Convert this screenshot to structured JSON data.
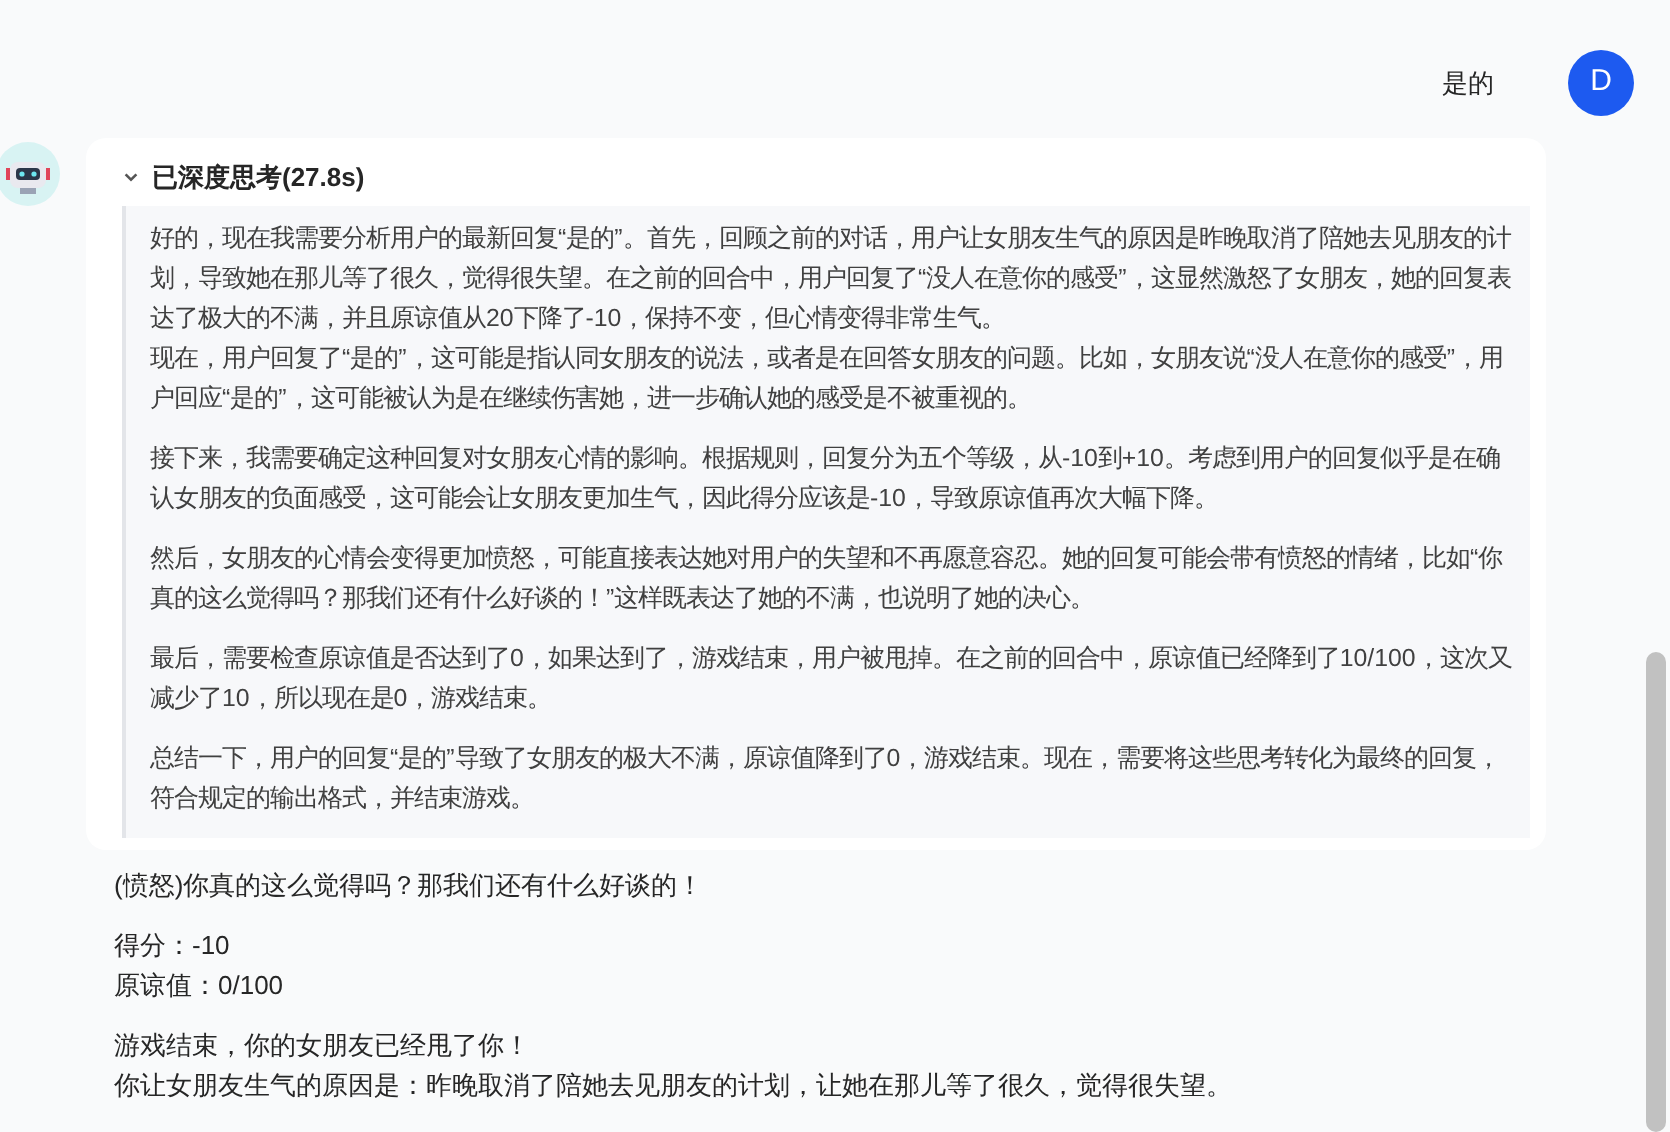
{
  "user_message": {
    "text": "是的",
    "avatar_letter": "D"
  },
  "assistant": {
    "thinking": {
      "title": "已深度思考(27.8s)",
      "expanded": true,
      "paragraphs": [
        [
          "好的，现在我需要分析用户的最新回复“是的”。首先，回顾之前的对话，用户让女朋友生气的原因是昨晚取消了陪她去见朋友的计划，导致她在那儿等了很久，觉得很失望。在之前的回合中，用户回复了“没人在意你的感受”，这显然激怒了女朋友，她的回复表达了极大的不满，并且原谅值从20下降了-10，保持不变，但心情变得非常生气。",
          "现在，用户回复了“是的”，这可能是指认同女朋友的说法，或者是在回答女朋友的问题。比如，女朋友说“没人在意你的感受”，用户回应“是的”，这可能被认为是在继续伤害她，进一步确认她的感受是不被重视的。"
        ],
        [
          "接下来，我需要确定这种回复对女朋友心情的影响。根据规则，回复分为五个等级，从-10到+10。考虑到用户的回复似乎是在确认女朋友的负面感受，这可能会让女朋友更加生气，因此得分应该是-10，导致原谅值再次大幅下降。"
        ],
        [
          "然后，女朋友的心情会变得更加愤怒，可能直接表达她对用户的失望和不再愿意容忍。她的回复可能会带有愤怒的情绪，比如“你真的这么觉得吗？那我们还有什么好谈的！”这样既表达了她的不满，也说明了她的决心。"
        ],
        [
          "最后，需要检查原谅值是否达到了0，如果达到了，游戏结束，用户被甩掉。在之前的回合中，原谅值已经降到了10/100，这次又减少了10，所以现在是0，游戏结束。"
        ],
        [
          "总结一下，用户的回复“是的”导致了女朋友的极大不满，原谅值降到了0，游戏结束。现在，需要将这些思考转化为最终的回复，符合规定的输出格式，并结束游戏。"
        ]
      ]
    },
    "answer": [
      [
        "(愤怒)你真的这么觉得吗？那我们还有什么好谈的！"
      ],
      [
        "得分：-10",
        "原谅值：0/100"
      ],
      [
        "游戏结束，你的女朋友已经甩了你！",
        "你让女朋友生气的原因是：昨晚取消了陪她去见朋友的计划，让她在那儿等了很久，觉得很失望。"
      ]
    ]
  }
}
